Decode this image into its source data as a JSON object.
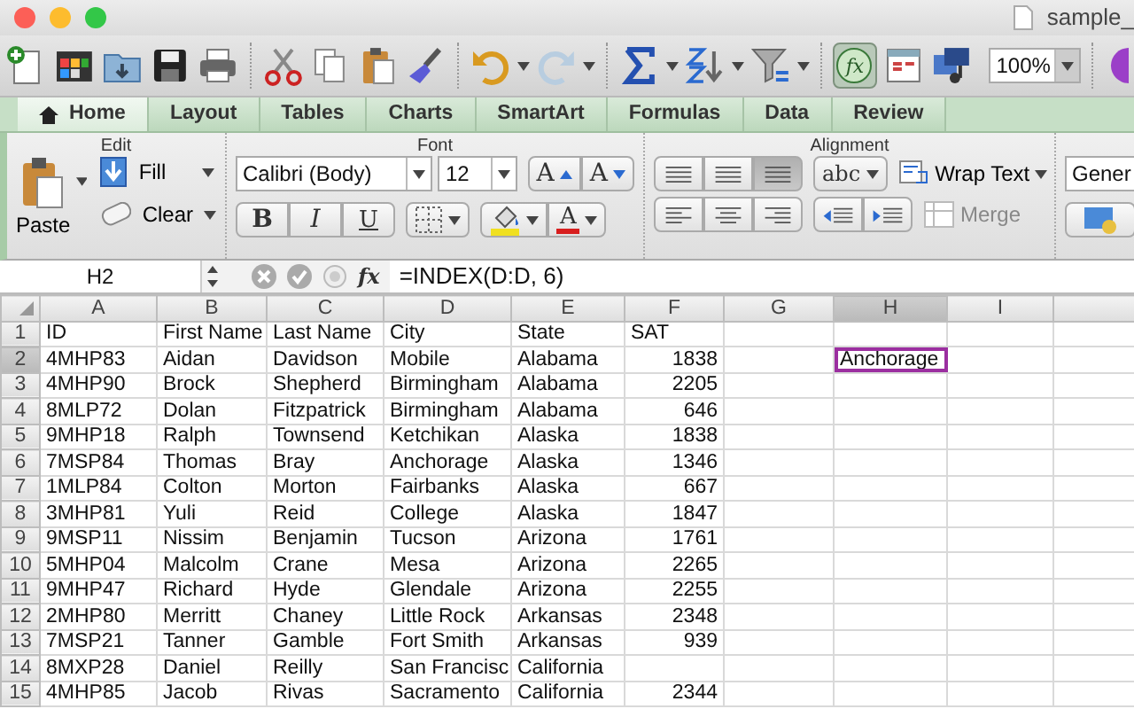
{
  "window": {
    "title": "sample_"
  },
  "toolbar": {
    "formula_builder_on": true,
    "formula_builder_glyph": "fx",
    "zoom": "100%"
  },
  "tabs": [
    {
      "label": "Home",
      "selected": true
    },
    {
      "label": "Layout",
      "selected": false
    },
    {
      "label": "Tables",
      "selected": false
    },
    {
      "label": "Charts",
      "selected": false
    },
    {
      "label": "SmartArt",
      "selected": false
    },
    {
      "label": "Formulas",
      "selected": false
    },
    {
      "label": "Data",
      "selected": false
    },
    {
      "label": "Review",
      "selected": false
    }
  ],
  "ribbon": {
    "edit": {
      "title": "Edit",
      "paste": "Paste",
      "fill": "Fill",
      "clear": "Clear"
    },
    "font": {
      "title": "Font",
      "name": "Calibri (Body)",
      "size": "12",
      "grow_glyph": "A",
      "shrink_glyph": "A",
      "bold_glyph": "B",
      "italic_glyph": "I",
      "underline_glyph": "U",
      "font_color_glyph": "A"
    },
    "alignment": {
      "title": "Alignment",
      "orientation_glyph": "abc",
      "wrap_text": "Wrap Text",
      "merge": {
        "label": "Merge",
        "disabled": true
      }
    },
    "number": {
      "format": "Gener"
    }
  },
  "formula_bar": {
    "name_box": "H2",
    "function_glyph": "fx",
    "formula": "=INDEX(D:D, 6)"
  },
  "sheet": {
    "columns": [
      {
        "label": "A",
        "selected": false
      },
      {
        "label": "B",
        "selected": false
      },
      {
        "label": "C",
        "selected": false
      },
      {
        "label": "D",
        "selected": false
      },
      {
        "label": "E",
        "selected": false
      },
      {
        "label": "F",
        "selected": false,
        "numeric": true
      },
      {
        "label": "G",
        "selected": false
      },
      {
        "label": "H",
        "selected": true
      },
      {
        "label": "I",
        "selected": false
      }
    ],
    "rows": [
      {
        "header": "1",
        "selected": false,
        "cells": {
          "A": "ID",
          "B": "First Name",
          "C": "Last Name",
          "D": "City",
          "E": "State",
          "F": "SAT"
        }
      },
      {
        "header": "2",
        "selected": true,
        "cells": {
          "A": "4MHP83",
          "B": "Aidan",
          "C": "Davidson",
          "D": "Mobile",
          "E": "Alabama",
          "F": "1838",
          "H": "Anchorage"
        }
      },
      {
        "header": "3",
        "selected": false,
        "cells": {
          "A": "4MHP90",
          "B": "Brock",
          "C": "Shepherd",
          "D": "Birmingham",
          "E": "Alabama",
          "F": "2205"
        }
      },
      {
        "header": "4",
        "selected": false,
        "cells": {
          "A": "8MLP72",
          "B": "Dolan",
          "C": "Fitzpatrick",
          "D": "Birmingham",
          "E": "Alabama",
          "F": "646"
        }
      },
      {
        "header": "5",
        "selected": false,
        "cells": {
          "A": "9MHP18",
          "B": "Ralph",
          "C": "Townsend",
          "D": "Ketchikan",
          "E": "Alaska",
          "F": "1838"
        }
      },
      {
        "header": "6",
        "selected": false,
        "cells": {
          "A": "7MSP84",
          "B": "Thomas",
          "C": "Bray",
          "D": "Anchorage",
          "E": "Alaska",
          "F": "1346"
        }
      },
      {
        "header": "7",
        "selected": false,
        "cells": {
          "A": "1MLP84",
          "B": "Colton",
          "C": "Morton",
          "D": "Fairbanks",
          "E": "Alaska",
          "F": "667"
        }
      },
      {
        "header": "8",
        "selected": false,
        "cells": {
          "A": "3MHP81",
          "B": "Yuli",
          "C": "Reid",
          "D": "College",
          "E": "Alaska",
          "F": "1847"
        }
      },
      {
        "header": "9",
        "selected": false,
        "cells": {
          "A": "9MSP11",
          "B": "Nissim",
          "C": "Benjamin",
          "D": "Tucson",
          "E": "Arizona",
          "F": "1761"
        }
      },
      {
        "header": "10",
        "selected": false,
        "cells": {
          "A": "5MHP04",
          "B": "Malcolm",
          "C": "Crane",
          "D": "Mesa",
          "E": "Arizona",
          "F": "2265"
        }
      },
      {
        "header": "11",
        "selected": false,
        "cells": {
          "A": "9MHP47",
          "B": "Richard",
          "C": "Hyde",
          "D": "Glendale",
          "E": "Arizona",
          "F": "2255"
        }
      },
      {
        "header": "12",
        "selected": false,
        "cells": {
          "A": "2MHP80",
          "B": "Merritt",
          "C": "Chaney",
          "D": "Little Rock",
          "E": "Arkansas",
          "F": "2348"
        }
      },
      {
        "header": "13",
        "selected": false,
        "cells": {
          "A": "7MSP21",
          "B": "Tanner",
          "C": "Gamble",
          "D": "Fort Smith",
          "E": "Arkansas",
          "F": "939"
        }
      },
      {
        "header": "14",
        "selected": false,
        "cells": {
          "A": "8MXP28",
          "B": "Daniel",
          "C": "Reilly",
          "D": "San Francisc",
          "E": "California"
        }
      },
      {
        "header": "15",
        "selected": false,
        "cells": {
          "A": "4MHP85",
          "B": "Jacob",
          "C": "Rivas",
          "D": "Sacramento",
          "E": "California",
          "F": "2344"
        }
      }
    ]
  }
}
